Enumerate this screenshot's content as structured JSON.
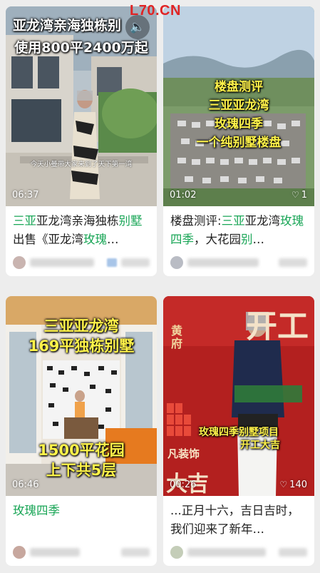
{
  "watermark": "L70.CN",
  "cards": [
    {
      "overlay_line1": "亚龙湾亲海独栋别",
      "overlay_line2": "使用800平2400万起",
      "subtitle": "今天小曼带大家来到了天下第一湾",
      "duration": "06:37",
      "title_hl1": "三亚",
      "title_t1": "亚龙湾亲海独栋",
      "title_hl2": "别墅",
      "title_t2": "出售《亚龙湾",
      "title_hl3": "玫瑰",
      "title_t3": "…"
    },
    {
      "overlay_line1": "楼盘测评",
      "overlay_line2": "三亚亚龙湾",
      "overlay_line3": "玫瑰四季",
      "overlay_line4": "一个纯别墅楼盘",
      "duration": "01:02",
      "likes": "1",
      "title_t1": "楼盘测评:",
      "title_hl1": "三亚",
      "title_t2": "亚龙湾",
      "title_hl2": "玫瑰四季",
      "title_t3": "，大花园",
      "title_hl3": "别",
      "title_t4": "…"
    },
    {
      "overlay_line1": "三亚亚龙湾",
      "overlay_line2": "169平独栋别墅",
      "overlay_line3": "1500平花园",
      "overlay_line4": "上下共5层",
      "duration": "06:46",
      "title_hl1": "玫瑰四季"
    },
    {
      "overlay_line1": "玫瑰四季别墅项目",
      "overlay_line2": "开工大吉",
      "bg_banner": "开工",
      "bg_left": "黄府",
      "bg_bottom": "大吉",
      "bg_mid": "凡装饰",
      "duration": "00:26",
      "likes": "140",
      "title_t1": "...正月十六，吉日吉时，我们迎来了新年…"
    }
  ],
  "colors": {
    "highlight": "#1aa657",
    "watermark": "#e02424",
    "overlay_yellow": "#fff34a"
  },
  "icons": [
    "sound-icon",
    "heart-icon"
  ]
}
